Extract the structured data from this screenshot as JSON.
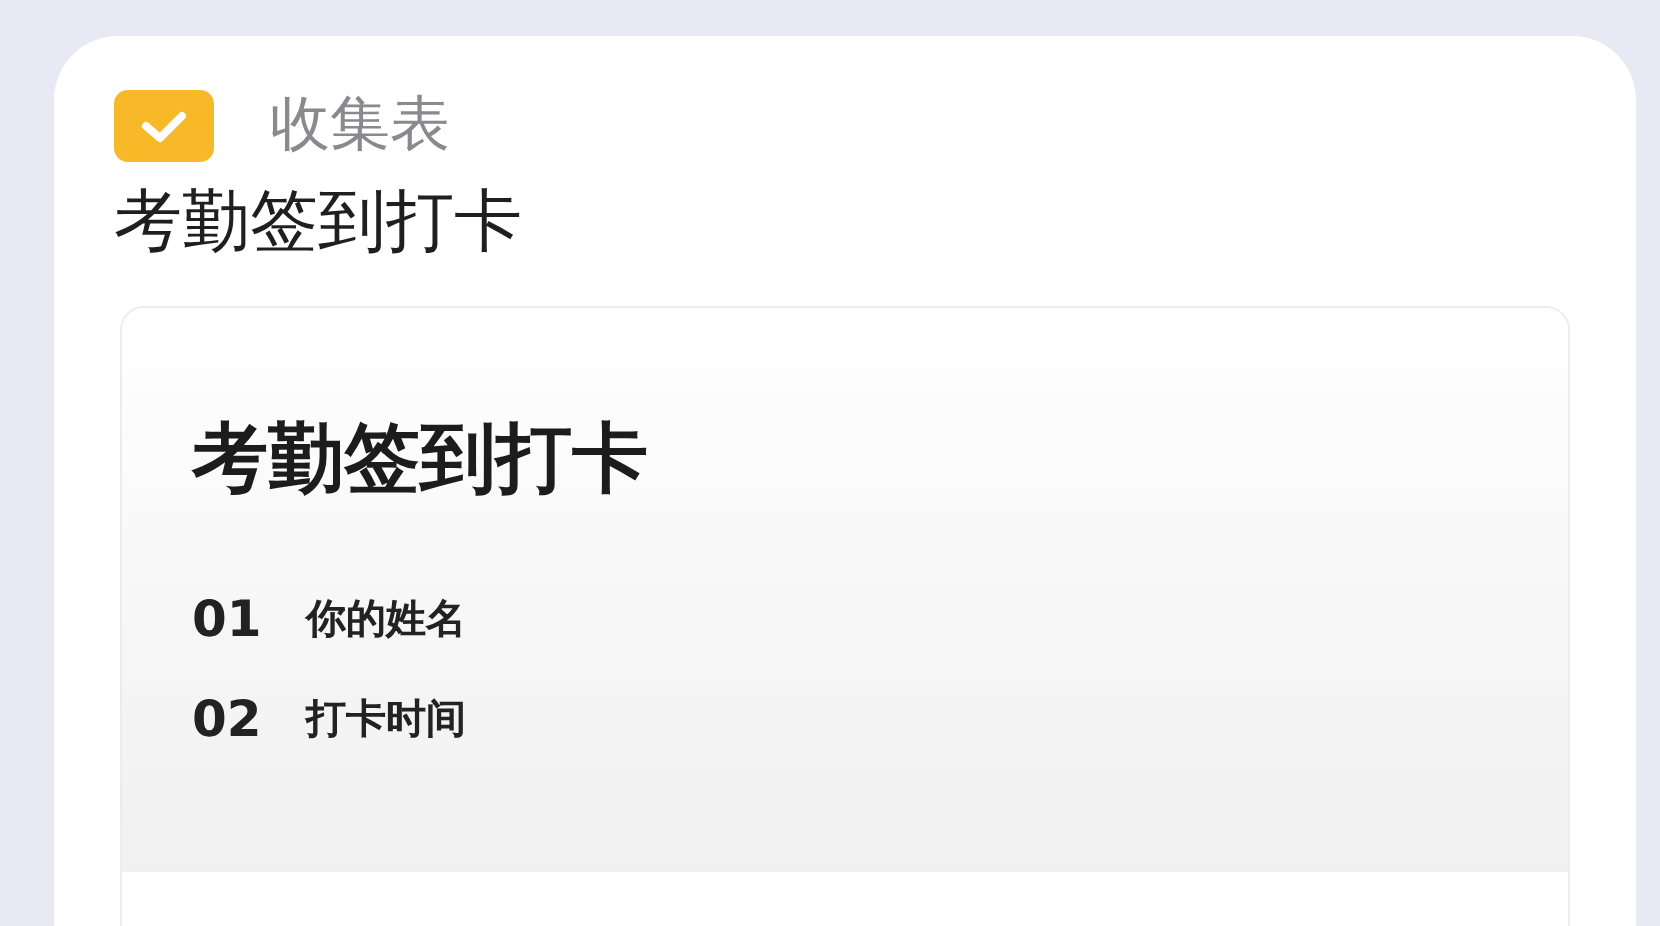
{
  "app": {
    "type_label": "收集表",
    "title": "考勤签到打卡"
  },
  "form_preview": {
    "title": "考勤签到打卡",
    "questions": [
      {
        "number": "01",
        "label": "你的姓名"
      },
      {
        "number": "02",
        "label": "打卡时间"
      }
    ]
  }
}
